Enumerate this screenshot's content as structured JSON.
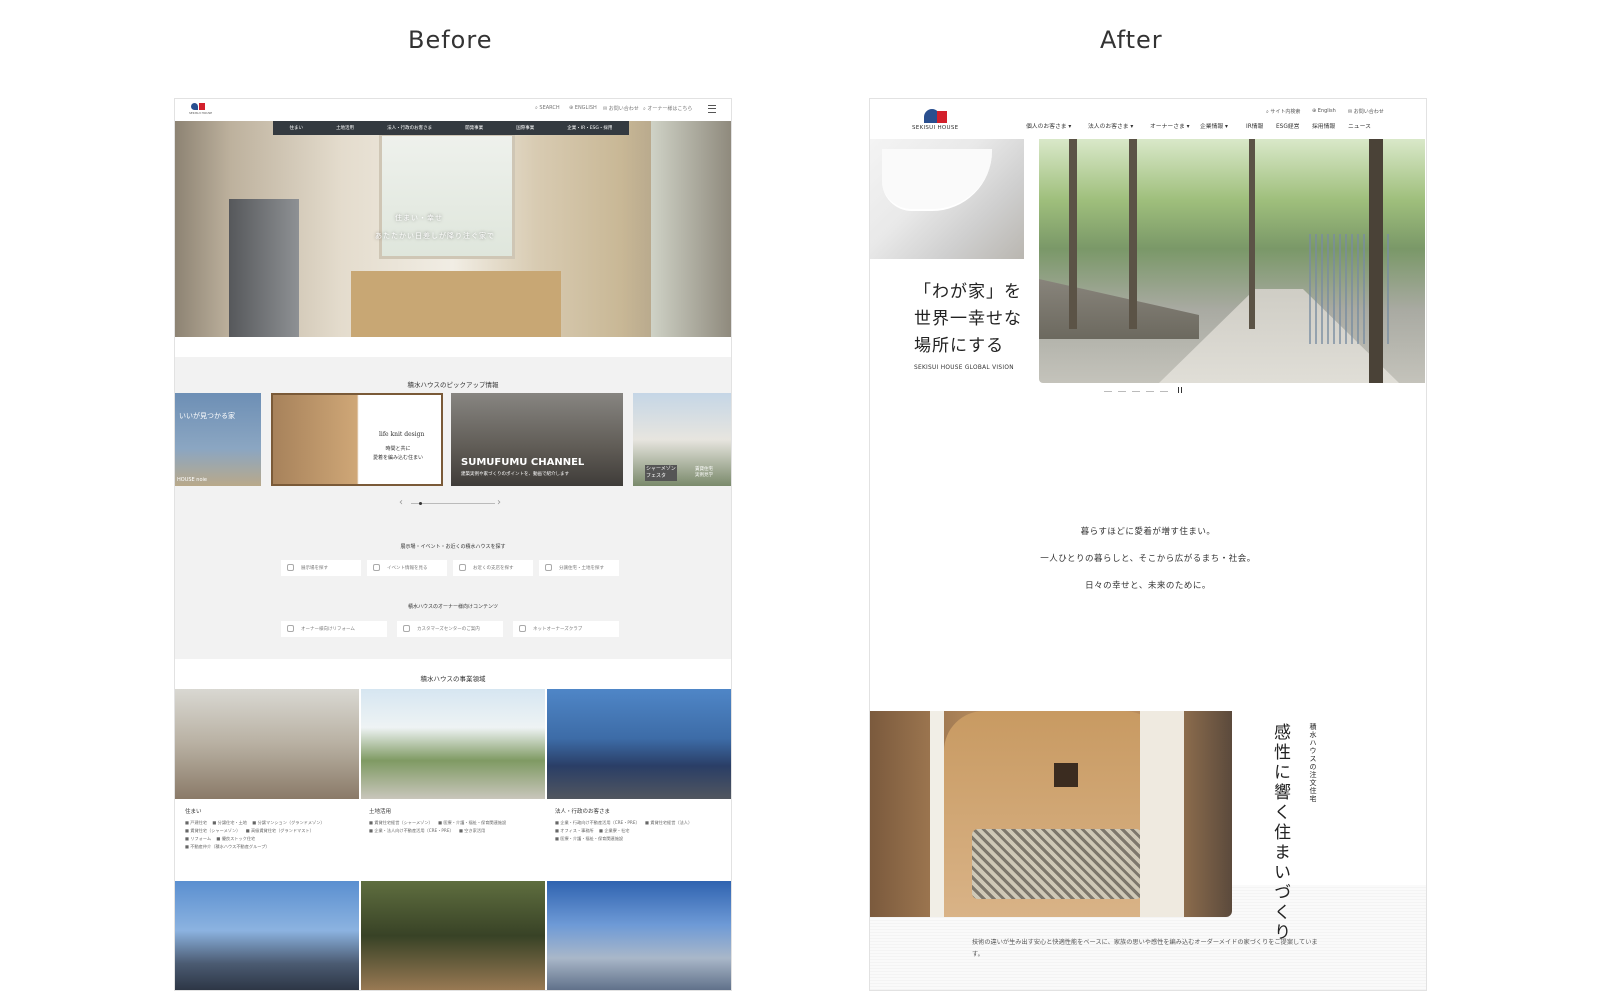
{
  "labels": {
    "before": "Before",
    "after": "After"
  },
  "before": {
    "logo_text": "SEKISUI HOUSE",
    "util": [
      "SEARCH",
      "ENGLISH",
      "お問い合わせ",
      "オーナー様はこちら"
    ],
    "nav": [
      "住まい",
      "土地活用",
      "法人・行政のお客さま",
      "開発事業",
      "国際事業",
      "企業・IR・ESG・採用"
    ],
    "hero_caption": [
      "住まい・幸せ",
      "あたたかい日差しが降り注ぐ家で"
    ],
    "pickup_title": "積水ハウスのピックアップ情報",
    "cards": [
      {
        "text": "いいが見つかる家",
        "sub": "HOUSE noie"
      },
      {
        "text": "life knit design",
        "sub": "時間と共に\n愛着を編み込む住まい"
      },
      {
        "text": "SUMUFUMU CHANNEL",
        "sub": "建築実例や家づくりのポイントを、動画で紹介します"
      },
      {
        "text": "シャーメゾン\nフェスタ",
        "sub": "賃貸住宅\n実例見学"
      }
    ],
    "find_title": "展示場・イベント・お近くの積水ハウスを探す",
    "find_buttons": [
      "展示場を探す",
      "イベント情報を見る",
      "お近くの支店を探す",
      "分譲住宅・土地を探す"
    ],
    "owner_title": "積水ハウスのオーナー様向けコンテンツ",
    "owner_buttons": [
      "オーナー様向けリフォーム",
      "カスタマーズセンターのご案内",
      "ネットオーナーズクラブ"
    ],
    "biz_title": "積水ハウスの事業領域",
    "biz": [
      {
        "label": "住まい",
        "items": "■ 戸建住宅    ■ 分譲住宅・土地    ■ 分譲マンション（グランドメゾン）\n■ 賃貸住宅（シャーメゾン）    ■ 高級賃貸住宅（グランドマスト）\n■ リフォーム    ■ 優良ストック住宅\n■ 不動産仲介（積水ハウス不動産グループ）"
      },
      {
        "label": "土地活用",
        "items": "■ 賃貸住宅経営（シャーメゾン）    ■ 医療・介護・福祉・保育関連施設\n■ 企業・法人向け不動産活用（CRE・PRE）    ■ 空き家活用"
      },
      {
        "label": "法人・行政のお客さま",
        "items": "■ 企業・行政向け不動産活用（CRE・PRE）    ■ 賃貸住宅経営（法人）\n■ オフィス・事務所    ■ 企業寮・社宅\n■ 医療・介護・福祉・保育関連施設"
      }
    ]
  },
  "after": {
    "logo_text": "SEKISUI HOUSE",
    "util": [
      "サイト内検索",
      "English",
      "お問い合わせ"
    ],
    "nav": [
      "個人のお客さま ▾",
      "法人のお客さま ▾",
      "オーナーさま ▾",
      "企業情報 ▾",
      "IR情報",
      "ESG経営",
      "採用情報",
      "ニュース"
    ],
    "vision": "「わが家」を\n世界一幸せな\n場所にする",
    "vision_sub": "SEKISUI HOUSE GLOBAL VISION",
    "copy": [
      "暮らすほどに愛着が増す住まい。",
      "一人ひとりの暮らしと、そこから広がるまち・社会。",
      "日々の幸せと、未来のために。"
    ],
    "section_title": "感性に響く住まいづくり",
    "section_sub": "積水ハウスの注文住宅",
    "description": "技術の違いが生み出す安心と快適性能をベースに、家族の思いや感性を編み込むオーダーメイドの家づくりをご提案しています。"
  }
}
